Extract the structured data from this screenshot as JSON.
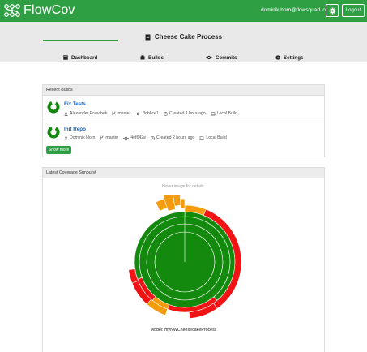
{
  "app": {
    "brand": "FlowCov",
    "user_email": "dominik.horn@flowsquad.io",
    "logout_label": "Logout"
  },
  "project": {
    "title": "Cheese Cake Process"
  },
  "tabs": [
    {
      "label": "Dashboard",
      "icon": "dashboard-icon",
      "active": true
    },
    {
      "label": "Builds",
      "icon": "builds-icon",
      "active": false
    },
    {
      "label": "Commits",
      "icon": "commit-icon",
      "active": false
    },
    {
      "label": "Settings",
      "icon": "gear-icon",
      "active": false
    }
  ],
  "recent_builds": {
    "title": "Recent Builds",
    "items": [
      {
        "name": "Fix Tests",
        "author": "Alexander Praschek",
        "branch": "master",
        "commit": "3cb6ce1",
        "created": "Created 1 hour ago",
        "source": "Local Build",
        "coverage": 0.85
      },
      {
        "name": "Init Repo",
        "author": "Dominik Horn",
        "branch": "master",
        "commit": "4ef642e",
        "created": "Created 2 hours ago",
        "source": "Local Build",
        "coverage": 0.85
      }
    ],
    "show_more_label": "Show more"
  },
  "sunburst": {
    "title": "Latest Coverage Sunburst",
    "hint": "Hover image for details.",
    "model_label": "Model: myNWCheesecakeProcess",
    "colors": {
      "covered": "#138a0e",
      "partial": "#f59c0e",
      "uncovered": "#f21414"
    }
  }
}
